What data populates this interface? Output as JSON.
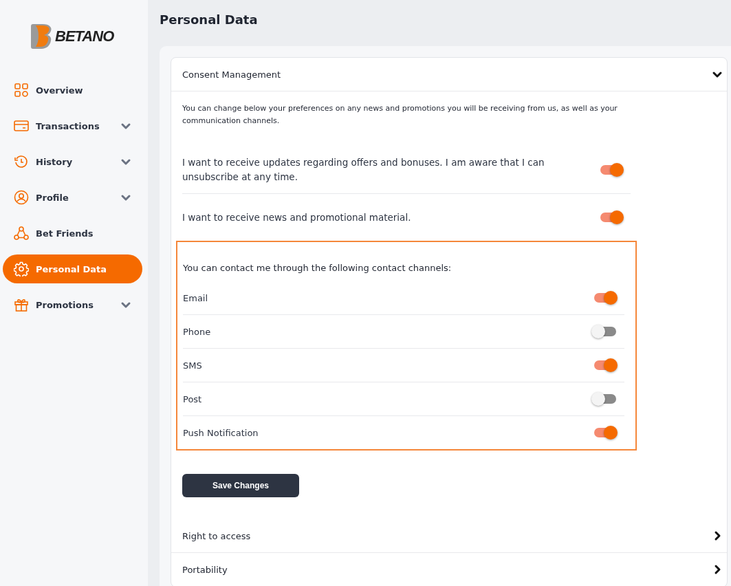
{
  "logo": {
    "text": "BETANO"
  },
  "sidebar": {
    "items": [
      {
        "label": "Overview",
        "selected": false,
        "expandable": false
      },
      {
        "label": "Transactions",
        "selected": false,
        "expandable": true
      },
      {
        "label": "History",
        "selected": false,
        "expandable": true
      },
      {
        "label": "Profile",
        "selected": false,
        "expandable": true
      },
      {
        "label": "Bet Friends",
        "selected": false,
        "expandable": false
      },
      {
        "label": "Personal Data",
        "selected": true,
        "expandable": false
      },
      {
        "label": "Promotions",
        "selected": false,
        "expandable": true
      }
    ]
  },
  "page_title": "Personal Data",
  "sections": [
    {
      "title": "Consent Management",
      "expanded": true,
      "description": "You can change below your preferences on any news and promotions you will be receiving from us, as well as your communication channels.",
      "consents": [
        {
          "label": "I want to receive updates regarding offers and bonuses. I am aware that I can unsubscribe at any time.",
          "on": true
        },
        {
          "label": "I want to receive news and promotional material.",
          "on": true
        }
      ],
      "channels_heading": "You can contact me through the following contact channels:",
      "channels": [
        {
          "label": "Email",
          "on": true
        },
        {
          "label": "Phone",
          "on": false
        },
        {
          "label": "SMS",
          "on": true
        },
        {
          "label": "Post",
          "on": false
        },
        {
          "label": "Push Notification",
          "on": true
        }
      ],
      "save_button": "Save Changes"
    },
    {
      "title": "Right to access",
      "expanded": false
    },
    {
      "title": "Portability",
      "expanded": false
    }
  ]
}
